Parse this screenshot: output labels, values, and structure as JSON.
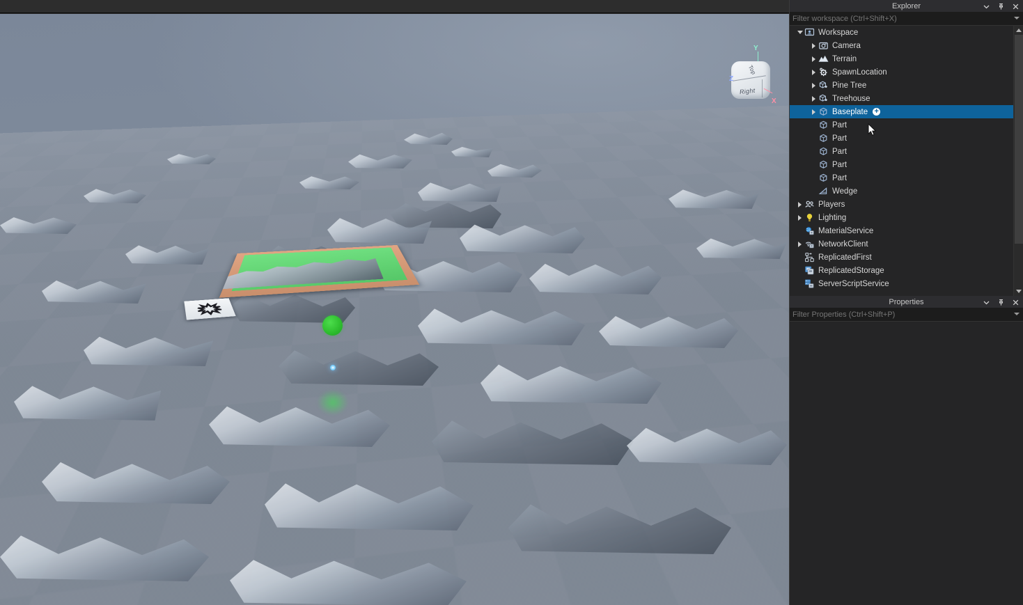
{
  "viewport": {
    "name": "3D viewport",
    "viewcube": {
      "top_face": "Top",
      "right_face": "Right",
      "axis_y": "Y",
      "axis_x": "X",
      "axis_z": "Z"
    },
    "objects": {
      "baseplate": "Baseplate",
      "grass_platform": "Grass Platform",
      "decal_tile": "Sunburst Decal Tile",
      "green_sphere": "Green Sphere Part",
      "blue_light": "Blue Point Light",
      "green_glow": "Green Glow"
    },
    "colors": {
      "sky": "#828c9c",
      "baseplate": "#7f8894",
      "grass": "#63d474",
      "platform_border": "#d99b76",
      "green_sphere": "#2fbf2f"
    }
  },
  "explorer": {
    "title": "Explorer",
    "filter_placeholder": "Filter workspace (Ctrl+Shift+X)",
    "window_buttons": [
      {
        "name": "chevron-down-icon",
        "label": "Options"
      },
      {
        "name": "pin-icon",
        "label": "Pin"
      },
      {
        "name": "close-icon",
        "label": "Close"
      }
    ],
    "selected_color": "#0e639c",
    "items": [
      {
        "label": "Workspace",
        "icon": "workspace-icon",
        "depth": 0,
        "twisty": "open",
        "selected": false,
        "badge": false
      },
      {
        "label": "Camera",
        "icon": "camera-icon",
        "depth": 1,
        "twisty": "closed",
        "selected": false,
        "badge": false
      },
      {
        "label": "Terrain",
        "icon": "terrain-icon",
        "depth": 1,
        "twisty": "closed",
        "selected": false,
        "badge": false
      },
      {
        "label": "SpawnLocation",
        "icon": "spawnlocation-icon",
        "depth": 1,
        "twisty": "closed",
        "selected": false,
        "badge": false
      },
      {
        "label": "Pine Tree",
        "icon": "model-icon",
        "depth": 1,
        "twisty": "closed",
        "selected": false,
        "badge": false
      },
      {
        "label": "Treehouse",
        "icon": "model-icon",
        "depth": 1,
        "twisty": "closed",
        "selected": false,
        "badge": false
      },
      {
        "label": "Baseplate",
        "icon": "part-icon",
        "depth": 1,
        "twisty": "closed",
        "selected": true,
        "badge": true
      },
      {
        "label": "Part",
        "icon": "part-icon",
        "depth": 1,
        "twisty": "none",
        "selected": false,
        "badge": false
      },
      {
        "label": "Part",
        "icon": "part-icon",
        "depth": 1,
        "twisty": "none",
        "selected": false,
        "badge": false
      },
      {
        "label": "Part",
        "icon": "part-icon",
        "depth": 1,
        "twisty": "none",
        "selected": false,
        "badge": false
      },
      {
        "label": "Part",
        "icon": "part-icon",
        "depth": 1,
        "twisty": "none",
        "selected": false,
        "badge": false
      },
      {
        "label": "Part",
        "icon": "part-icon",
        "depth": 1,
        "twisty": "none",
        "selected": false,
        "badge": false
      },
      {
        "label": "Wedge",
        "icon": "wedge-icon",
        "depth": 1,
        "twisty": "none",
        "selected": false,
        "badge": false
      },
      {
        "label": "Players",
        "icon": "players-icon",
        "depth": 0,
        "twisty": "closed",
        "selected": false,
        "badge": false
      },
      {
        "label": "Lighting",
        "icon": "lighting-icon",
        "depth": 0,
        "twisty": "closed",
        "selected": false,
        "badge": false
      },
      {
        "label": "MaterialService",
        "icon": "materialservice-icon",
        "depth": 0,
        "twisty": "none",
        "selected": false,
        "badge": false
      },
      {
        "label": "NetworkClient",
        "icon": "networkclient-icon",
        "depth": 0,
        "twisty": "closed",
        "selected": false,
        "badge": false
      },
      {
        "label": "ReplicatedFirst",
        "icon": "replicatedfirst-icon",
        "depth": 0,
        "twisty": "none",
        "selected": false,
        "badge": false
      },
      {
        "label": "ReplicatedStorage",
        "icon": "replicatedstorage-icon",
        "depth": 0,
        "twisty": "none",
        "selected": false,
        "badge": false
      },
      {
        "label": "ServerScriptService",
        "icon": "serverscriptservice-icon",
        "depth": 0,
        "twisty": "none",
        "selected": false,
        "badge": false
      }
    ]
  },
  "properties": {
    "title": "Properties",
    "filter_placeholder": "Filter Properties (Ctrl+Shift+P)",
    "window_buttons": [
      {
        "name": "chevron-down-icon",
        "label": "Options"
      },
      {
        "name": "pin-icon",
        "label": "Pin"
      },
      {
        "name": "close-icon",
        "label": "Close"
      }
    ]
  }
}
